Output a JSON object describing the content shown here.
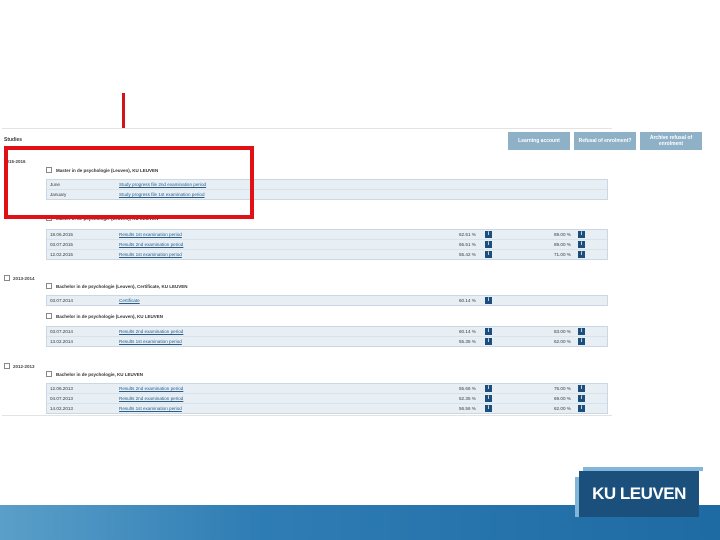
{
  "studies_label": "Studies",
  "buttons": {
    "learning_account": "Learning account",
    "refusal": "Refusal of enrolment?",
    "archive_refusal": "Archive refusal of enrolment"
  },
  "years": [
    {
      "label": "2015-2016",
      "programmes": [
        {
          "name": "Master in de psychologie (Leuven), KU LEUVEN",
          "rows": [
            {
              "date": "June",
              "desc": "Study progress file 2nd examination period",
              "pct1": "",
              "pct2": ""
            },
            {
              "date": "January",
              "desc": "Study progress file 1st examination period",
              "pct1": "",
              "pct2": ""
            }
          ]
        },
        {
          "name": "Master in de psychologie (Leuven), KU LEUVEN",
          "rows": [
            {
              "date": "18.06.2015",
              "desc": "Results 1st examination period",
              "pct1": "62.51 %",
              "pct2": "89.00 %"
            },
            {
              "date": "03.07.2015",
              "desc": "Results 2nd examination period",
              "pct1": "65.51 %",
              "pct2": "89.00 %"
            },
            {
              "date": "12.02.2015",
              "desc": "Results 1st examination period",
              "pct1": "55.42 %",
              "pct2": "71.00 %"
            }
          ]
        }
      ]
    },
    {
      "label": "2013-2014",
      "programmes": [
        {
          "name": "Bachelor in de psychologie (Leuven), Certificate, KU LEUVEN",
          "rows": [
            {
              "date": "03.07.2014",
              "desc": "Certificate",
              "pct1": "60.14 %",
              "pct2": ""
            }
          ]
        },
        {
          "name": "Bachelor in de psychologie (Leuven), KU LEUVEN",
          "rows": [
            {
              "date": "03.07.2014",
              "desc": "Results 2nd examination period",
              "pct1": "60.14 %",
              "pct2": "83.00 %"
            },
            {
              "date": "13.02.2014",
              "desc": "Results 1st examination period",
              "pct1": "55.35 %",
              "pct2": "62.00 %"
            }
          ]
        }
      ]
    },
    {
      "label": "2012-2013",
      "programmes": [
        {
          "name": "Bachelor in de psychologie, KU LEUVEN",
          "rows": [
            {
              "date": "12.06.2013",
              "desc": "Results 2nd examination period",
              "pct1": "55.66 %",
              "pct2": "76.00 %"
            },
            {
              "date": "04.07.2013",
              "desc": "Results 2nd examination period",
              "pct1": "52.35 %",
              "pct2": "69.00 %"
            },
            {
              "date": "14.02.2013",
              "desc": "Results 1st examination period",
              "pct1": "56.56 %",
              "pct2": "62.00 %"
            }
          ]
        }
      ]
    }
  ],
  "info_glyph": "i",
  "logo": {
    "text": "KU LEUVEN"
  },
  "colors": {
    "highlight_box": "#e01014",
    "arrow": "#d2141a",
    "button_bg": "#8fb1c8",
    "table_bg": "#e7eff5",
    "logo_bg": "#1b4f7c",
    "footer": "#2f7db4"
  }
}
